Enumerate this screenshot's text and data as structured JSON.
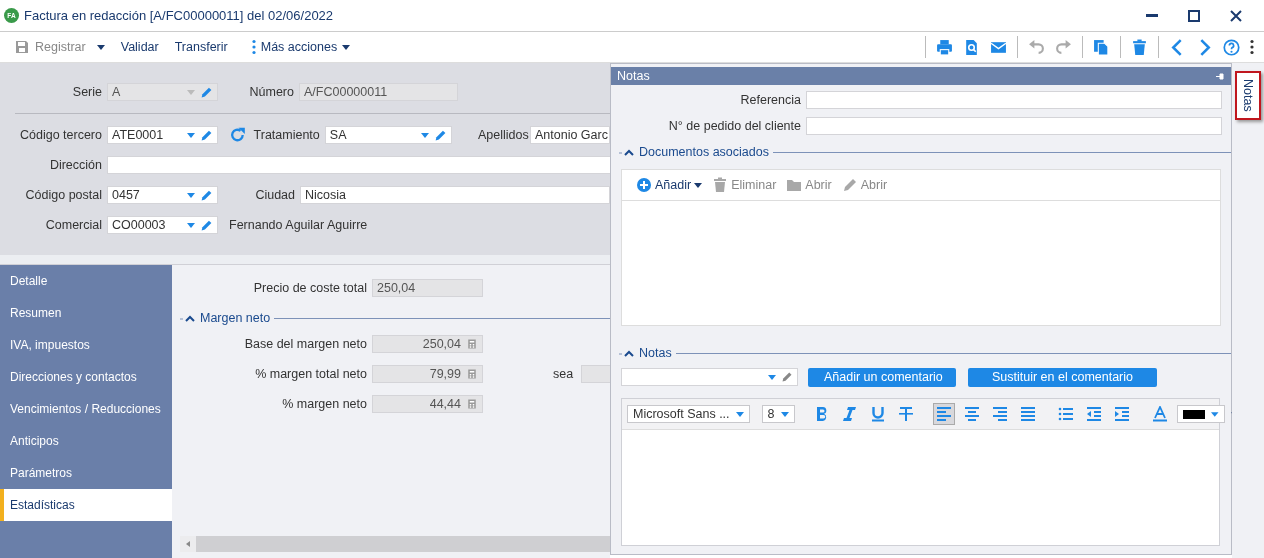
{
  "window": {
    "badge": "FA",
    "title": "Factura en redacción [A/FC00000011] del 02/06/2022"
  },
  "toolbar": {
    "actions": [
      {
        "label": "Registrar",
        "kind": "save",
        "disabled": true
      },
      {
        "label": "Validar",
        "kind": "plain",
        "disabled": false
      },
      {
        "label": "Transferir",
        "kind": "plain",
        "disabled": false
      },
      {
        "label": "Más acciones",
        "kind": "more",
        "disabled": false
      }
    ],
    "icon_groups": [
      [
        {
          "kind": "print",
          "disabled": false
        },
        {
          "kind": "preview",
          "disabled": false
        },
        {
          "kind": "mail",
          "disabled": false
        }
      ],
      [
        {
          "kind": "undo",
          "disabled": true
        },
        {
          "kind": "redo",
          "disabled": true
        }
      ],
      [
        {
          "kind": "copy",
          "disabled": false
        }
      ],
      [
        {
          "kind": "delete",
          "disabled": false
        }
      ],
      [
        {
          "kind": "prev",
          "disabled": false
        },
        {
          "kind": "next",
          "disabled": false
        },
        {
          "kind": "help",
          "disabled": false
        },
        {
          "kind": "menu",
          "disabled": false
        }
      ]
    ]
  },
  "header": {
    "serie": {
      "label": "Serie",
      "value": "A"
    },
    "numero": {
      "label": "Número",
      "value": "A/FC00000011"
    },
    "codigo_tercero": {
      "label": "Código tercero",
      "value": "ATE0001"
    },
    "tratamiento": {
      "label": "Tratamiento",
      "value": "SA"
    },
    "apellidos": {
      "label": "Apellidos",
      "value": "Antonio Garc"
    },
    "direccion": {
      "label": "Dirección"
    },
    "codigo_postal": {
      "label": "Código postal",
      "value": "0457"
    },
    "ciudad": {
      "label": "Ciudad",
      "value": "Nicosia"
    },
    "comercial": {
      "label": "Comercial",
      "value": "CO00003",
      "name": "Fernando Aguilar Aguirre"
    }
  },
  "sidebar": {
    "items": [
      {
        "label": "Detalle",
        "selected": false
      },
      {
        "label": "Resumen",
        "selected": false
      },
      {
        "label": "IVA, impuestos",
        "selected": false
      },
      {
        "label": "Direcciones y contactos",
        "selected": false
      },
      {
        "label": "Vencimientos / Reducciones",
        "selected": false
      },
      {
        "label": "Anticipos",
        "selected": false
      },
      {
        "label": "Parámetros",
        "selected": false
      },
      {
        "label": "Estadísticas",
        "selected": true
      }
    ]
  },
  "statistics": {
    "precio_coste": {
      "label": "Precio de coste total",
      "value": "250,04"
    },
    "margen_section": {
      "title": "Margen neto",
      "expanded": true
    },
    "margen_fields": [
      {
        "label": "Base del margen neto",
        "value": "250,04"
      },
      {
        "label": "% margen total neto",
        "value": "79,99"
      },
      {
        "label": "% margen neto",
        "value": "44,44"
      }
    ],
    "extra_label": "sea"
  },
  "notes_panel": {
    "title": "Notas",
    "referencia": {
      "label": "Referencia"
    },
    "pedido": {
      "label": "N° de pedido del cliente"
    },
    "documents": {
      "title": "Documentos asociados",
      "expanded": true,
      "actions": [
        {
          "label": "Añadir",
          "kind": "add",
          "disabled": false
        },
        {
          "label": "Eliminar",
          "kind": "delete",
          "disabled": true
        },
        {
          "label": "Abrir",
          "kind": "folder",
          "disabled": true
        },
        {
          "label": "Abrir",
          "kind": "edit",
          "disabled": true
        }
      ]
    },
    "notes": {
      "title": "Notas",
      "expanded": true,
      "buttons": [
        "Añadir un comentario",
        "Sustituir en el comentario"
      ],
      "font": "Microsoft Sans ...",
      "size": "8",
      "format_groups": [
        [
          {
            "kind": "bold",
            "selected": false
          },
          {
            "kind": "italic",
            "selected": false
          },
          {
            "kind": "underline",
            "selected": false
          },
          {
            "kind": "strike",
            "selected": false
          }
        ],
        [
          {
            "kind": "align-left",
            "selected": true
          },
          {
            "kind": "align-center",
            "selected": false
          },
          {
            "kind": "align-right",
            "selected": false
          },
          {
            "kind": "justify",
            "selected": false
          }
        ],
        [
          {
            "kind": "bullets",
            "selected": false
          },
          {
            "kind": "outdent",
            "selected": false
          },
          {
            "kind": "indent",
            "selected": false
          }
        ],
        [
          {
            "kind": "font-color",
            "selected": false,
            "color": "#000000"
          }
        ]
      ]
    }
  },
  "side_tab": {
    "label": "Notas",
    "selected": true
  }
}
